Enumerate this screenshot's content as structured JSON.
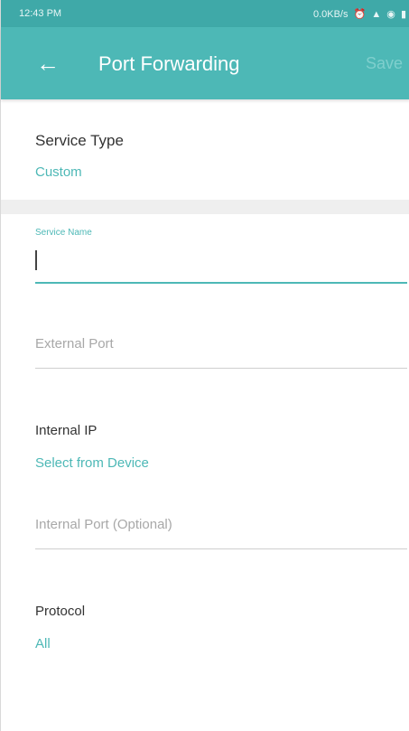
{
  "status_bar": {
    "time": "12:43 PM",
    "network_speed": "0.0KB/s",
    "icons": [
      "alarm-icon",
      "signal-icon",
      "wifi-icon",
      "battery-icon"
    ]
  },
  "app_bar": {
    "title": "Port Forwarding",
    "action_label": "Save",
    "background_color": "#4db8b6"
  },
  "service_type": {
    "label": "Service Type",
    "value": "Custom"
  },
  "service_name": {
    "label": "Service Name",
    "value": ""
  },
  "external_port": {
    "placeholder": "External Port",
    "value": ""
  },
  "internal_ip": {
    "label": "Internal IP",
    "value": "Select from Device"
  },
  "internal_port": {
    "placeholder": "Internal Port (Optional)",
    "value": ""
  },
  "protocol": {
    "label": "Protocol",
    "value": "All"
  },
  "colors": {
    "accent": "#4db8b6",
    "status_bar": "#3fa9a8"
  }
}
